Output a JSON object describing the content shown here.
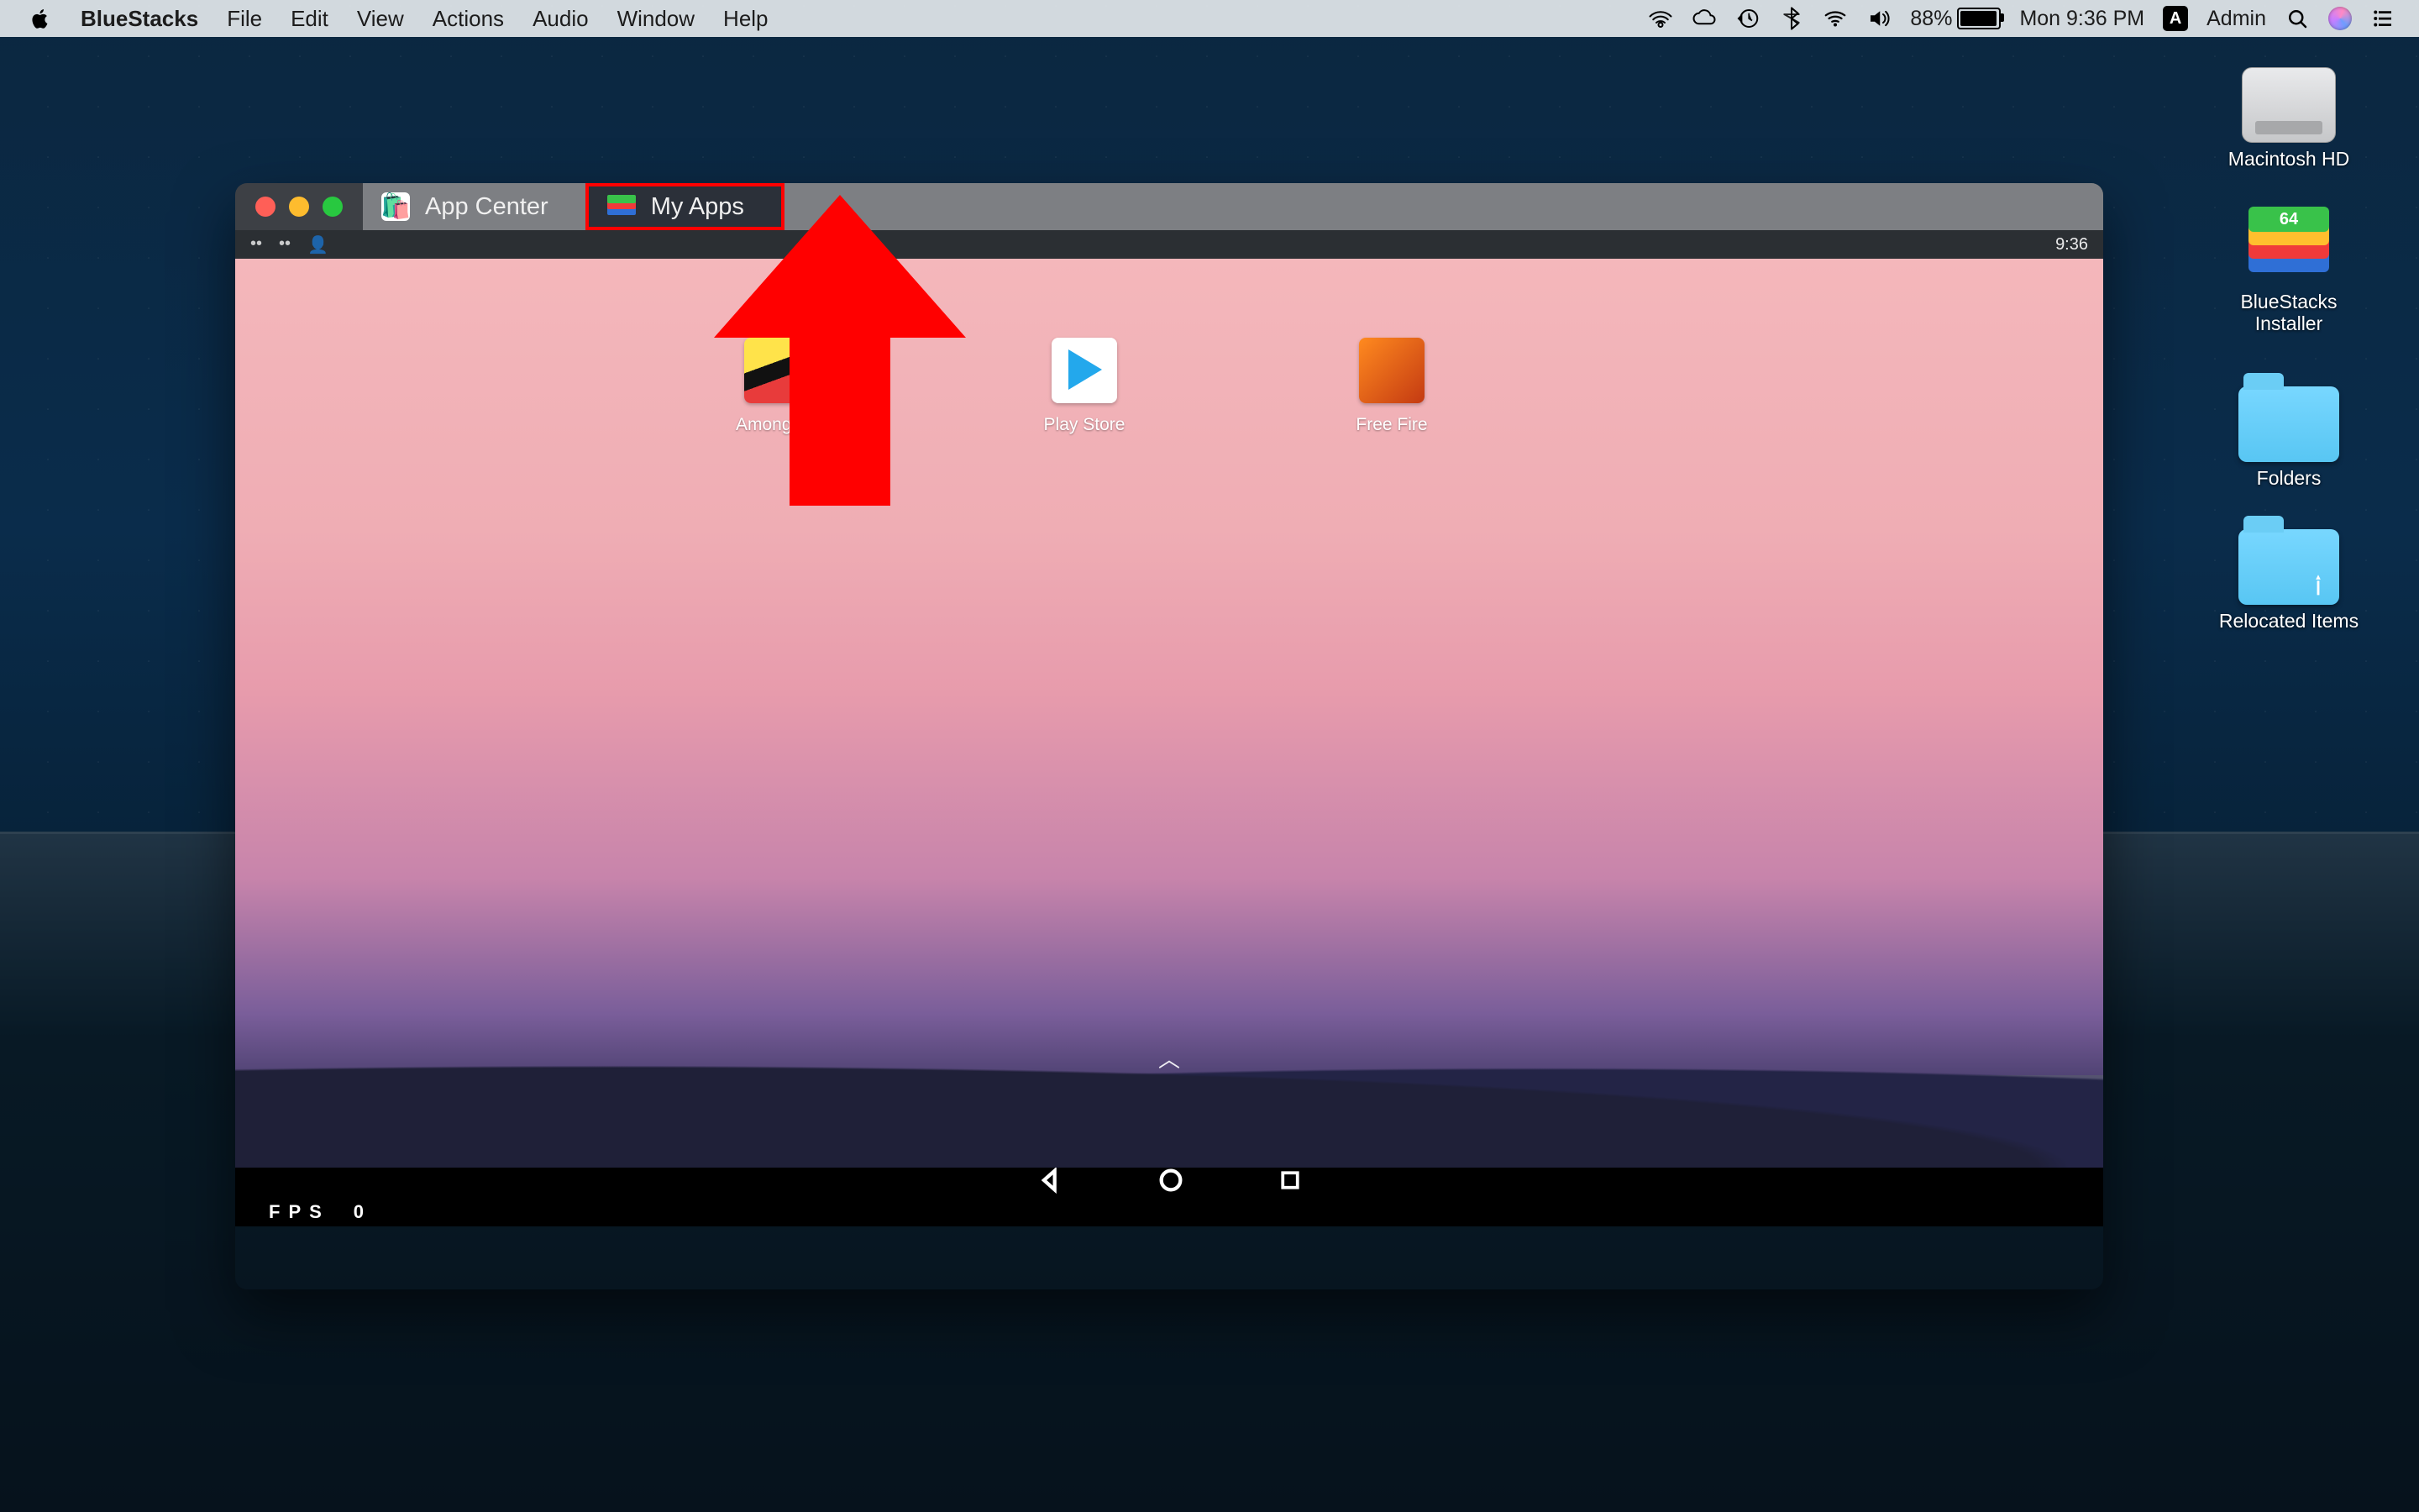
{
  "menubar": {
    "app_name": "BlueStacks",
    "items": [
      "File",
      "Edit",
      "View",
      "Actions",
      "Audio",
      "Window",
      "Help"
    ],
    "battery_pct": "88%",
    "clock": "Mon 9:36 PM",
    "user": "Admin",
    "user_badge": "A"
  },
  "desktop_icons": {
    "hd": "Macintosh HD",
    "installer": "BlueStacks Installer",
    "installer_badge": "64",
    "folders": "Folders",
    "relocated": "Relocated Items"
  },
  "bs": {
    "tabs": {
      "app_center": "App Center",
      "my_apps": "My Apps"
    },
    "status_time": "9:36",
    "apps": {
      "amongus": "Among Us",
      "playstore": "Play Store",
      "freefire": "Free Fire"
    },
    "fps_label": "FPS",
    "fps_value": "0"
  }
}
